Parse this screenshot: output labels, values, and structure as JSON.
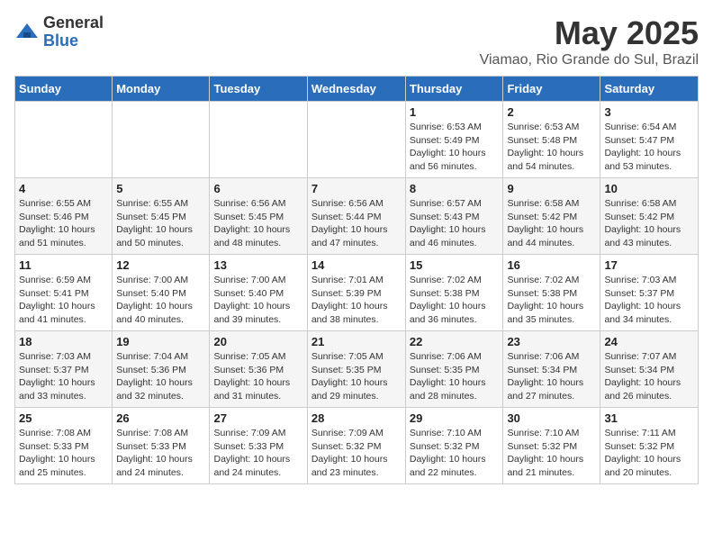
{
  "header": {
    "logo_general": "General",
    "logo_blue": "Blue",
    "month_title": "May 2025",
    "location": "Viamao, Rio Grande do Sul, Brazil"
  },
  "days_of_week": [
    "Sunday",
    "Monday",
    "Tuesday",
    "Wednesday",
    "Thursday",
    "Friday",
    "Saturday"
  ],
  "weeks": [
    [
      {
        "day": "",
        "info": ""
      },
      {
        "day": "",
        "info": ""
      },
      {
        "day": "",
        "info": ""
      },
      {
        "day": "",
        "info": ""
      },
      {
        "day": "1",
        "info": "Sunrise: 6:53 AM\nSunset: 5:49 PM\nDaylight: 10 hours\nand 56 minutes."
      },
      {
        "day": "2",
        "info": "Sunrise: 6:53 AM\nSunset: 5:48 PM\nDaylight: 10 hours\nand 54 minutes."
      },
      {
        "day": "3",
        "info": "Sunrise: 6:54 AM\nSunset: 5:47 PM\nDaylight: 10 hours\nand 53 minutes."
      }
    ],
    [
      {
        "day": "4",
        "info": "Sunrise: 6:55 AM\nSunset: 5:46 PM\nDaylight: 10 hours\nand 51 minutes."
      },
      {
        "day": "5",
        "info": "Sunrise: 6:55 AM\nSunset: 5:45 PM\nDaylight: 10 hours\nand 50 minutes."
      },
      {
        "day": "6",
        "info": "Sunrise: 6:56 AM\nSunset: 5:45 PM\nDaylight: 10 hours\nand 48 minutes."
      },
      {
        "day": "7",
        "info": "Sunrise: 6:56 AM\nSunset: 5:44 PM\nDaylight: 10 hours\nand 47 minutes."
      },
      {
        "day": "8",
        "info": "Sunrise: 6:57 AM\nSunset: 5:43 PM\nDaylight: 10 hours\nand 46 minutes."
      },
      {
        "day": "9",
        "info": "Sunrise: 6:58 AM\nSunset: 5:42 PM\nDaylight: 10 hours\nand 44 minutes."
      },
      {
        "day": "10",
        "info": "Sunrise: 6:58 AM\nSunset: 5:42 PM\nDaylight: 10 hours\nand 43 minutes."
      }
    ],
    [
      {
        "day": "11",
        "info": "Sunrise: 6:59 AM\nSunset: 5:41 PM\nDaylight: 10 hours\nand 41 minutes."
      },
      {
        "day": "12",
        "info": "Sunrise: 7:00 AM\nSunset: 5:40 PM\nDaylight: 10 hours\nand 40 minutes."
      },
      {
        "day": "13",
        "info": "Sunrise: 7:00 AM\nSunset: 5:40 PM\nDaylight: 10 hours\nand 39 minutes."
      },
      {
        "day": "14",
        "info": "Sunrise: 7:01 AM\nSunset: 5:39 PM\nDaylight: 10 hours\nand 38 minutes."
      },
      {
        "day": "15",
        "info": "Sunrise: 7:02 AM\nSunset: 5:38 PM\nDaylight: 10 hours\nand 36 minutes."
      },
      {
        "day": "16",
        "info": "Sunrise: 7:02 AM\nSunset: 5:38 PM\nDaylight: 10 hours\nand 35 minutes."
      },
      {
        "day": "17",
        "info": "Sunrise: 7:03 AM\nSunset: 5:37 PM\nDaylight: 10 hours\nand 34 minutes."
      }
    ],
    [
      {
        "day": "18",
        "info": "Sunrise: 7:03 AM\nSunset: 5:37 PM\nDaylight: 10 hours\nand 33 minutes."
      },
      {
        "day": "19",
        "info": "Sunrise: 7:04 AM\nSunset: 5:36 PM\nDaylight: 10 hours\nand 32 minutes."
      },
      {
        "day": "20",
        "info": "Sunrise: 7:05 AM\nSunset: 5:36 PM\nDaylight: 10 hours\nand 31 minutes."
      },
      {
        "day": "21",
        "info": "Sunrise: 7:05 AM\nSunset: 5:35 PM\nDaylight: 10 hours\nand 29 minutes."
      },
      {
        "day": "22",
        "info": "Sunrise: 7:06 AM\nSunset: 5:35 PM\nDaylight: 10 hours\nand 28 minutes."
      },
      {
        "day": "23",
        "info": "Sunrise: 7:06 AM\nSunset: 5:34 PM\nDaylight: 10 hours\nand 27 minutes."
      },
      {
        "day": "24",
        "info": "Sunrise: 7:07 AM\nSunset: 5:34 PM\nDaylight: 10 hours\nand 26 minutes."
      }
    ],
    [
      {
        "day": "25",
        "info": "Sunrise: 7:08 AM\nSunset: 5:33 PM\nDaylight: 10 hours\nand 25 minutes."
      },
      {
        "day": "26",
        "info": "Sunrise: 7:08 AM\nSunset: 5:33 PM\nDaylight: 10 hours\nand 24 minutes."
      },
      {
        "day": "27",
        "info": "Sunrise: 7:09 AM\nSunset: 5:33 PM\nDaylight: 10 hours\nand 24 minutes."
      },
      {
        "day": "28",
        "info": "Sunrise: 7:09 AM\nSunset: 5:32 PM\nDaylight: 10 hours\nand 23 minutes."
      },
      {
        "day": "29",
        "info": "Sunrise: 7:10 AM\nSunset: 5:32 PM\nDaylight: 10 hours\nand 22 minutes."
      },
      {
        "day": "30",
        "info": "Sunrise: 7:10 AM\nSunset: 5:32 PM\nDaylight: 10 hours\nand 21 minutes."
      },
      {
        "day": "31",
        "info": "Sunrise: 7:11 AM\nSunset: 5:32 PM\nDaylight: 10 hours\nand 20 minutes."
      }
    ]
  ]
}
